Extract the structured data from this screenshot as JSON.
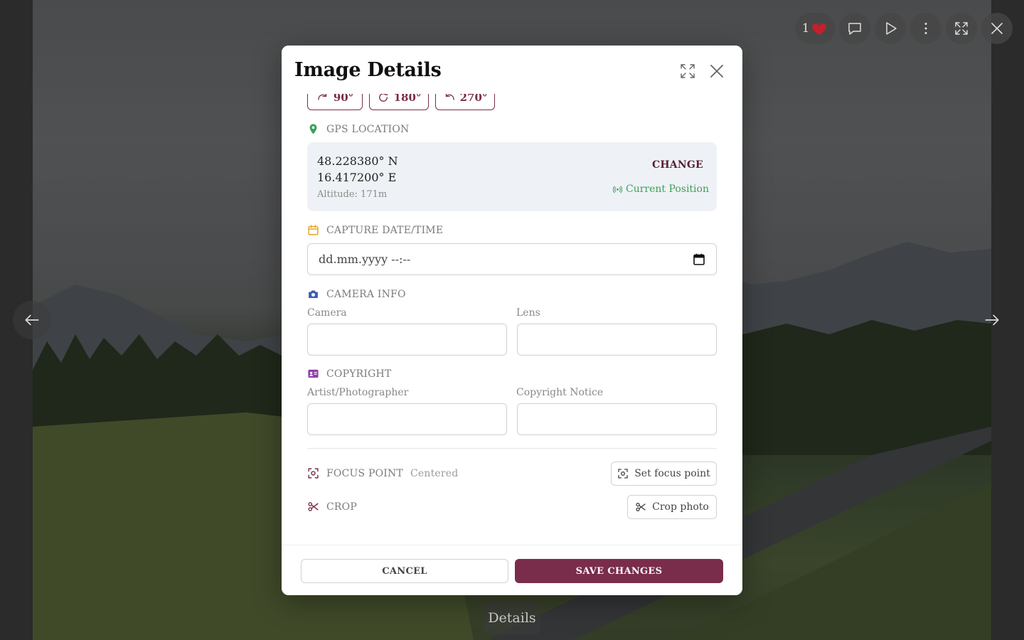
{
  "viewer": {
    "like_count": "1",
    "details_label": "Details",
    "icons": [
      "heart-icon",
      "comment-icon",
      "play-icon",
      "more-vertical-icon",
      "fullscreen-icon",
      "close-icon",
      "arrow-left-icon",
      "arrow-right-icon"
    ]
  },
  "modal": {
    "title": "Image Details",
    "rotate_buttons": [
      {
        "label": "90°"
      },
      {
        "label": "180°"
      },
      {
        "label": "270°"
      }
    ],
    "gps": {
      "section_label": "GPS LOCATION",
      "latitude": "48.228380° N",
      "longitude": "16.417200° E",
      "altitude": "Altitude: 171m",
      "change_label": "CHANGE",
      "current_position_label": "Current Position"
    },
    "capture": {
      "section_label": "CAPTURE DATE/TIME",
      "placeholder": "dd.mm.yyyy --:--"
    },
    "camera": {
      "section_label": "CAMERA INFO",
      "camera_label": "Camera",
      "camera_value": "",
      "lens_label": "Lens",
      "lens_value": ""
    },
    "copyright": {
      "section_label": "COPYRIGHT",
      "artist_label": "Artist/Photographer",
      "artist_value": "",
      "notice_label": "Copyright Notice",
      "notice_value": ""
    },
    "focus": {
      "section_label": "FOCUS POINT",
      "status": "Centered",
      "button_label": "Set focus point"
    },
    "crop": {
      "section_label": "CROP",
      "button_label": "Crop photo"
    },
    "footer": {
      "cancel_label": "CANCEL",
      "save_label": "SAVE CHANGES"
    }
  },
  "colors": {
    "accent": "#7a2c4b",
    "gps_green": "#3e9f5a",
    "calendar_orange": "#e3a21a",
    "camera_blue": "#3b5bb5",
    "copyright_purple": "#8b3fa8",
    "heart_red": "#c4202a"
  }
}
